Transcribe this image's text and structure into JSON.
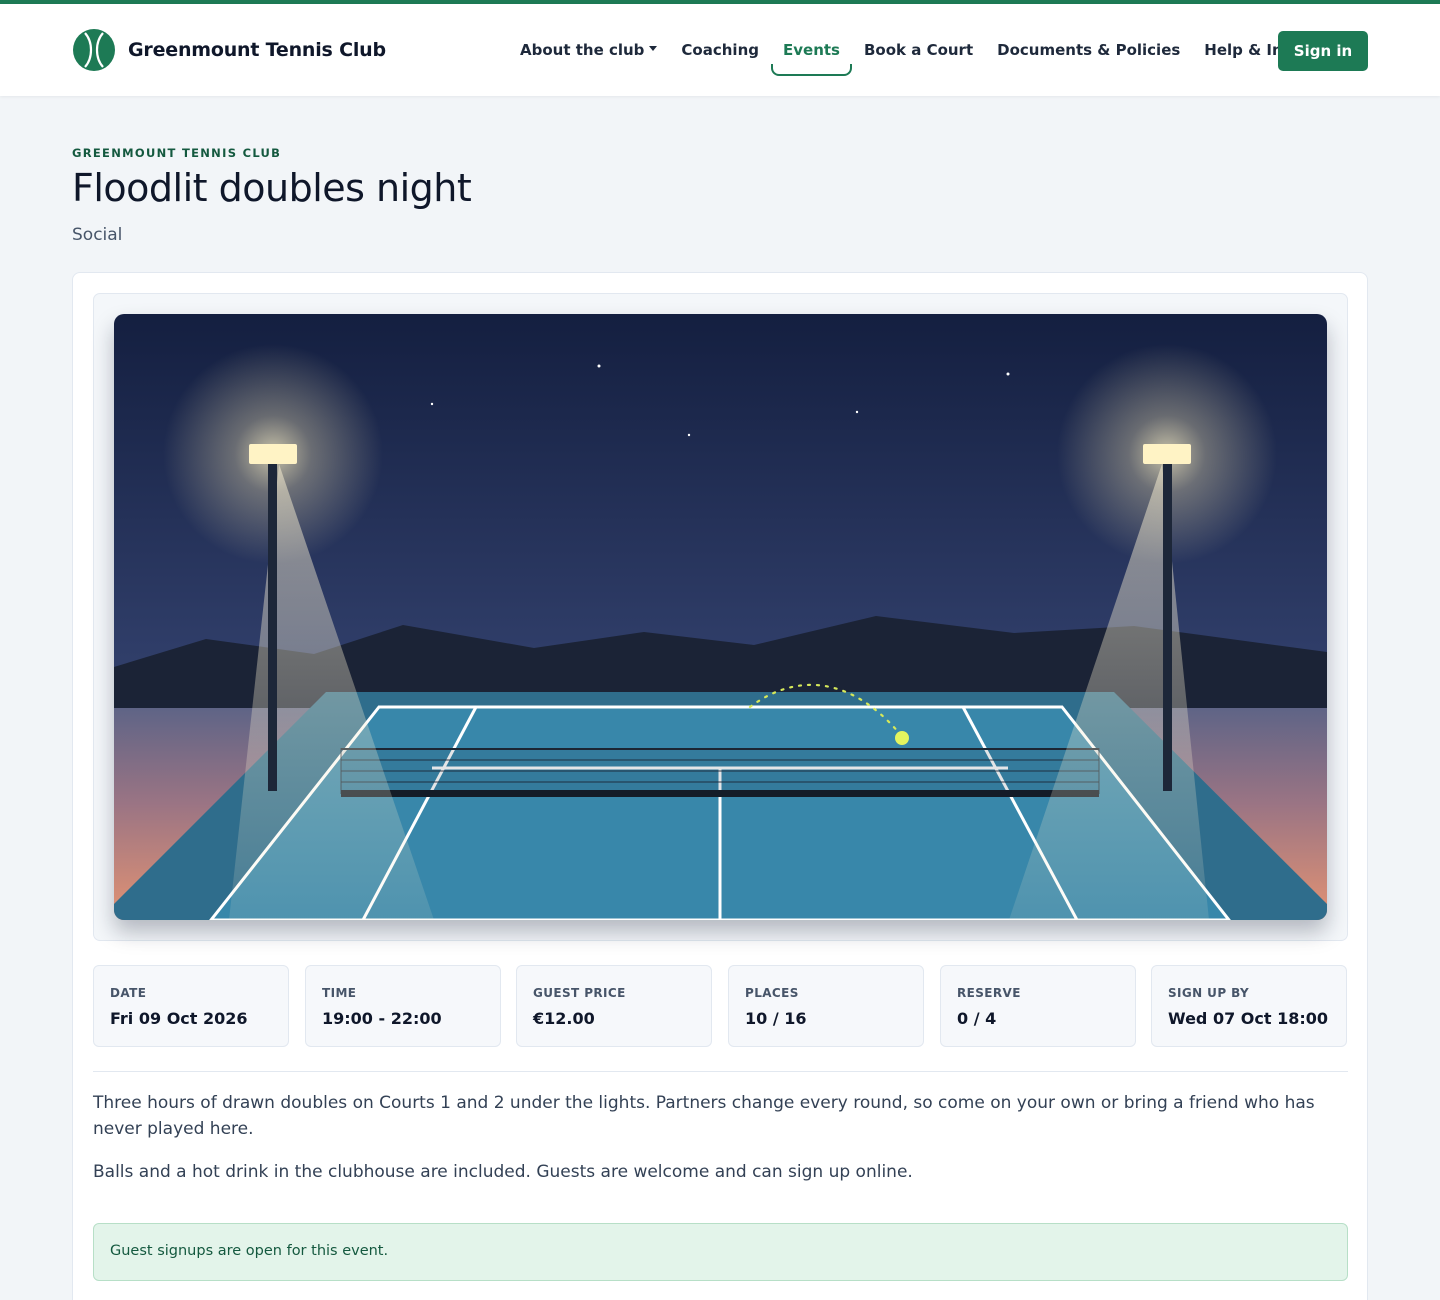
{
  "brand": {
    "name": "Greenmount Tennis Club",
    "logo_icon": "tennis-ball-icon",
    "brand_color": "#1d7a55"
  },
  "nav": {
    "items": [
      {
        "label": "About the club",
        "has_dropdown": true,
        "active": false
      },
      {
        "label": "Coaching",
        "has_dropdown": false,
        "active": false
      },
      {
        "label": "Events",
        "has_dropdown": false,
        "active": true
      },
      {
        "label": "Book a Court",
        "has_dropdown": false,
        "active": false
      },
      {
        "label": "Documents & Policies",
        "has_dropdown": false,
        "active": false
      },
      {
        "label": "Help & Info",
        "has_dropdown": true,
        "active": false
      }
    ],
    "signin_label": "Sign in"
  },
  "event": {
    "eyebrow": "GREENMOUNT TENNIS CLUB",
    "title": "Floodlit doubles night",
    "category": "Social",
    "image": {
      "scene": "floodlit-tennis-court-illustration"
    },
    "stats": [
      {
        "label": "DATE",
        "value": "Fri 09 Oct 2026"
      },
      {
        "label": "TIME",
        "value": "19:00 - 22:00"
      },
      {
        "label": "GUEST PRICE",
        "value": "€12.00"
      },
      {
        "label": "PLACES",
        "value": "10 / 16"
      },
      {
        "label": "RESERVE",
        "value": "0 / 4"
      },
      {
        "label": "SIGN UP BY",
        "value": "Wed 07 Oct 18:00"
      }
    ],
    "description": [
      "Three hours of drawn doubles on Courts 1 and 2 under the lights. Partners change every round, so come on your own or bring a friend who has never played here.",
      "Balls and a hot drink in the clubhouse are included. Guests are welcome and can sign up online."
    ],
    "alert": "Guest signups are open for this event."
  },
  "colors": {
    "accent": "#1d7a55",
    "alert_bg": "#e3f4ea",
    "alert_text": "#14593f",
    "page_bg": "#f2f5f8"
  }
}
